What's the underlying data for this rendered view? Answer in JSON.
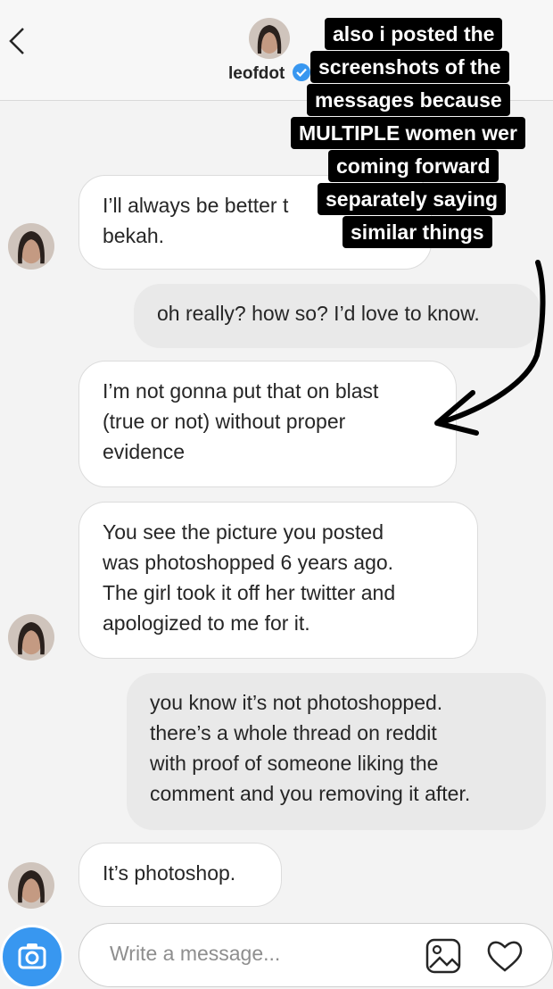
{
  "header": {
    "username": "leofdot",
    "back_icon": "chevron-left-icon",
    "verified_icon": "verified-badge-icon"
  },
  "story_caption": {
    "lines": [
      "also i posted the",
      "screenshots of the",
      "messages because",
      "MULTIPLE women wer",
      "coming forward",
      "separately saying",
      "similar things"
    ]
  },
  "messages": [
    {
      "direction": "incoming",
      "lines": [
        "I’ll always be better t",
        "bekah."
      ]
    },
    {
      "direction": "outgoing",
      "lines": [
        "oh really? how so? I’d love to know."
      ]
    },
    {
      "direction": "incoming",
      "lines": [
        "I’m not gonna put that on blast",
        "(true or not) without proper",
        "evidence"
      ]
    },
    {
      "direction": "incoming",
      "lines": [
        "You see the picture you posted",
        "was photoshopped 6 years ago.",
        "The girl took it off her twitter and",
        "apologized to me for it."
      ]
    },
    {
      "direction": "outgoing",
      "lines": [
        "you know it’s not photoshopped.",
        "there’s a whole thread on reddit",
        "with proof of someone liking the",
        "comment and you removing it after."
      ]
    },
    {
      "direction": "incoming",
      "lines": [
        "It’s photoshop."
      ]
    }
  ],
  "composer": {
    "placeholder": "Write a message...",
    "camera_icon": "camera-icon",
    "gallery_icon": "gallery-icon",
    "heart_icon": "heart-icon"
  },
  "colors": {
    "accent_blue": "#3897f0",
    "caption_bg": "#000000",
    "caption_text": "#ffffff"
  }
}
